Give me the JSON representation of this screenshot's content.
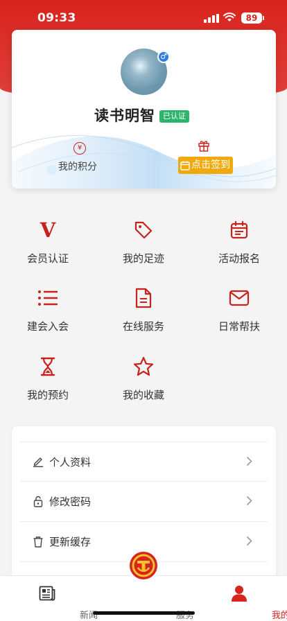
{
  "status_bar": {
    "time": "09:33",
    "battery": "89"
  },
  "profile": {
    "username": "读书明智",
    "verified_badge": "已认证",
    "gender_icon": "male-icon",
    "points_label": "我的积分",
    "checkin_label": "点击签到"
  },
  "grid_menu": [
    {
      "label": "会员认证",
      "icon": "member-v-icon"
    },
    {
      "label": "我的足迹",
      "icon": "tag-icon"
    },
    {
      "label": "活动报名",
      "icon": "calendar-icon"
    },
    {
      "label": "建会入会",
      "icon": "list-icon"
    },
    {
      "label": "在线服务",
      "icon": "document-icon"
    },
    {
      "label": "日常帮扶",
      "icon": "mail-icon"
    },
    {
      "label": "我的预约",
      "icon": "hourglass-icon"
    },
    {
      "label": "我的收藏",
      "icon": "star-icon"
    }
  ],
  "settings": [
    {
      "label": "个人资料",
      "icon": "edit-icon"
    },
    {
      "label": "修改密码",
      "icon": "lock-icon"
    },
    {
      "label": "更新缓存",
      "icon": "trash-icon"
    }
  ],
  "tab_bar": {
    "tabs": [
      {
        "label": "新闻",
        "icon": "newspaper-icon"
      },
      {
        "label": "服务",
        "icon": "union-emblem-icon"
      },
      {
        "label": "我的",
        "icon": "person-icon"
      }
    ],
    "active_index": 2
  },
  "colors": {
    "brand_red": "#d8241d",
    "accent_orange": "#f2a90d",
    "verified_green": "#2db36b"
  }
}
